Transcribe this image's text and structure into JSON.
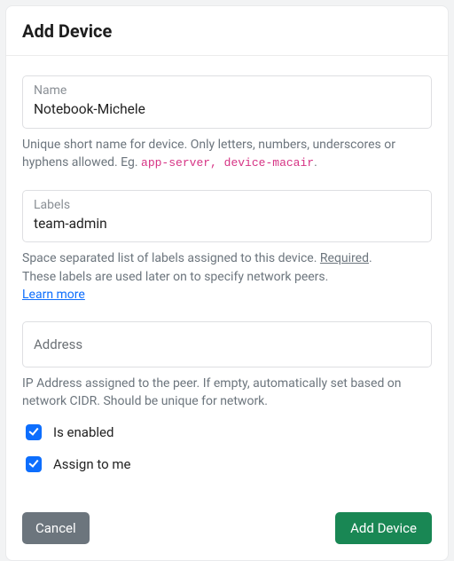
{
  "header": {
    "title": "Add Device"
  },
  "form": {
    "name": {
      "label": "Name",
      "value": "Notebook-Michele",
      "help_text": "Unique short name for device. Only letters, numbers, underscores or hyphens allowed. Eg. ",
      "help_code1": "app-server",
      "help_sep": ", ",
      "help_code2": "device-macair",
      "help_end": "."
    },
    "labels": {
      "label": "Labels",
      "value": "team-admin",
      "help_line1a": "Space separated list of labels assigned to this device. ",
      "help_line1b": "Required",
      "help_line1c": ".",
      "help_line2": "These labels are used later on to specify network peers.",
      "learn_more": "Learn more"
    },
    "address": {
      "label": "Address",
      "value": "",
      "help": "IP Address assigned to the peer. If empty, automatically set based on network CIDR. Should be unique for network."
    },
    "enabled_label": "Is enabled",
    "assign_label": "Assign to me"
  },
  "footer": {
    "cancel": "Cancel",
    "submit": "Add Device"
  }
}
